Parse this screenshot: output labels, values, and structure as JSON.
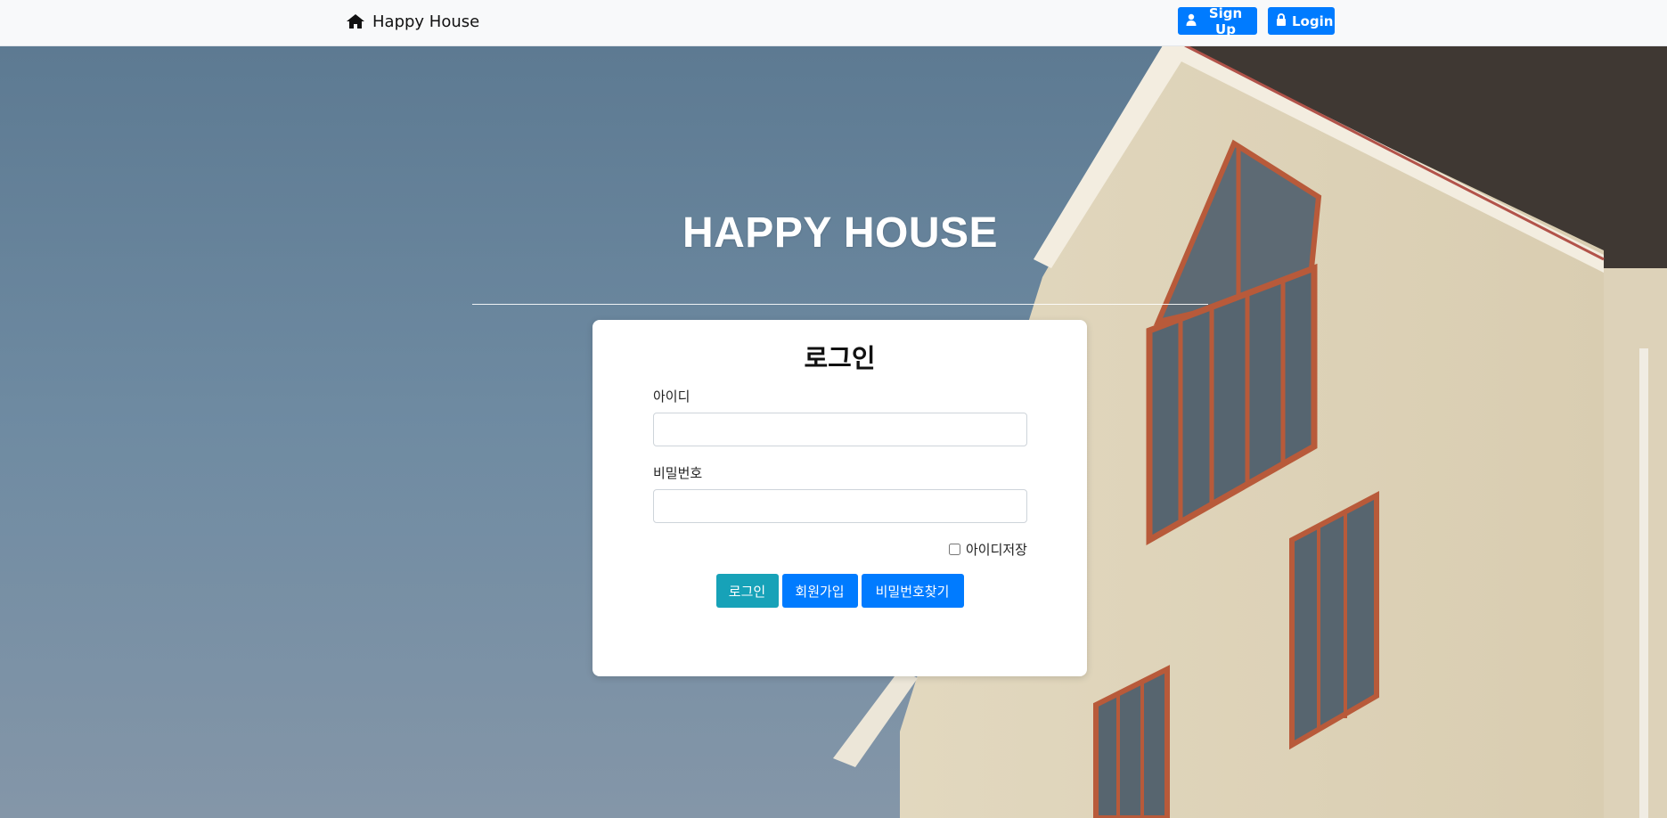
{
  "navbar": {
    "brand": "Happy House",
    "signup_label": "Sign Up",
    "login_label": "Login"
  },
  "hero": {
    "title": "HAPPY HOUSE"
  },
  "login_card": {
    "title": "로그인",
    "id_label": "아이디",
    "id_value": "",
    "password_label": "비밀번호",
    "password_value": "",
    "remember_label": "아이디저장",
    "remember_checked": false,
    "buttons": {
      "login": "로그인",
      "signup": "회원가입",
      "find_password": "비밀번호찾기"
    }
  },
  "colors": {
    "navbar_bg": "#f8f9fa",
    "primary": "#007bff",
    "info": "#17a2b8",
    "sky": "#6f8aa3",
    "wall": "#e6dcc4"
  }
}
